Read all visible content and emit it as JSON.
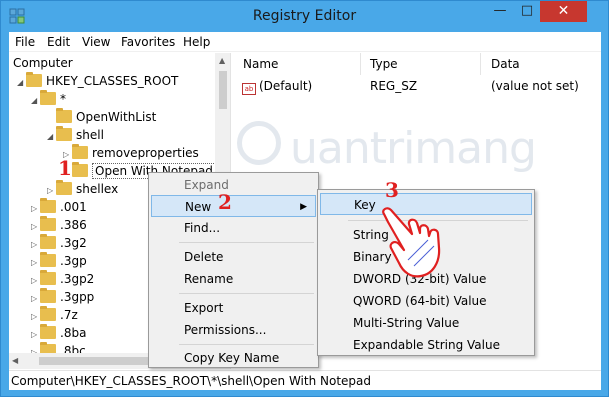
{
  "window": {
    "title": "Registry Editor",
    "minimize": "—",
    "maximize": "□",
    "close": "✕"
  },
  "menu": [
    "File",
    "Edit",
    "View",
    "Favorites",
    "Help"
  ],
  "tree": {
    "root": "Computer",
    "items": [
      {
        "label": "HKEY_CLASSES_ROOT",
        "indent": 0,
        "toggle": "◢"
      },
      {
        "label": "*",
        "indent": 1,
        "toggle": "◢"
      },
      {
        "label": "OpenWithList",
        "indent": 2,
        "toggle": ""
      },
      {
        "label": "shell",
        "indent": 2,
        "toggle": "◢"
      },
      {
        "label": "removeproperties",
        "indent": 3,
        "toggle": "▷"
      },
      {
        "label": "Open With Notepad",
        "indent": 3,
        "toggle": "",
        "selected": true
      },
      {
        "label": "shellex",
        "indent": 2,
        "toggle": "▷"
      },
      {
        "label": ".001",
        "indent": 1,
        "toggle": "▷"
      },
      {
        "label": ".386",
        "indent": 1,
        "toggle": "▷"
      },
      {
        "label": ".3g2",
        "indent": 1,
        "toggle": "▷"
      },
      {
        "label": ".3gp",
        "indent": 1,
        "toggle": "▷"
      },
      {
        "label": ".3gp2",
        "indent": 1,
        "toggle": "▷"
      },
      {
        "label": ".3gpp",
        "indent": 1,
        "toggle": "▷"
      },
      {
        "label": ".7z",
        "indent": 1,
        "toggle": "▷"
      },
      {
        "label": ".8ba",
        "indent": 1,
        "toggle": "▷"
      },
      {
        "label": ".8bc",
        "indent": 1,
        "toggle": "▷"
      }
    ]
  },
  "values": {
    "headers": {
      "name": "Name",
      "type": "Type",
      "data": "Data"
    },
    "rows": [
      {
        "name": "(Default)",
        "type": "REG_SZ",
        "data": "(value not set)",
        "icon": "ab"
      }
    ]
  },
  "watermark": "uantrimang",
  "context_menu": {
    "items": [
      "Expand",
      "New",
      "Find...",
      "Delete",
      "Rename",
      "Export",
      "Permissions...",
      "Copy Key Name"
    ]
  },
  "submenu": {
    "items": [
      "Key",
      "String Value",
      "Binary Value",
      "DWORD (32-bit) Value",
      "QWORD (64-bit) Value",
      "Multi-String Value",
      "Expandable String Value"
    ],
    "visible": [
      "Key",
      "String",
      "Binary",
      "DWORD (32-bit) Value",
      "QWORD (64-bit) Value",
      "Multi-String Value",
      "Expandable String Value"
    ]
  },
  "steps": [
    "1",
    "2",
    "3"
  ],
  "status": "Computer\\HKEY_CLASSES_ROOT\\*\\shell\\Open With Notepad",
  "colors": {
    "titlebar": "#49A8E8",
    "close": "#C7372F",
    "highlight": "#D5E7F8",
    "step": "#E02020",
    "folder": "#E8BE4E"
  }
}
